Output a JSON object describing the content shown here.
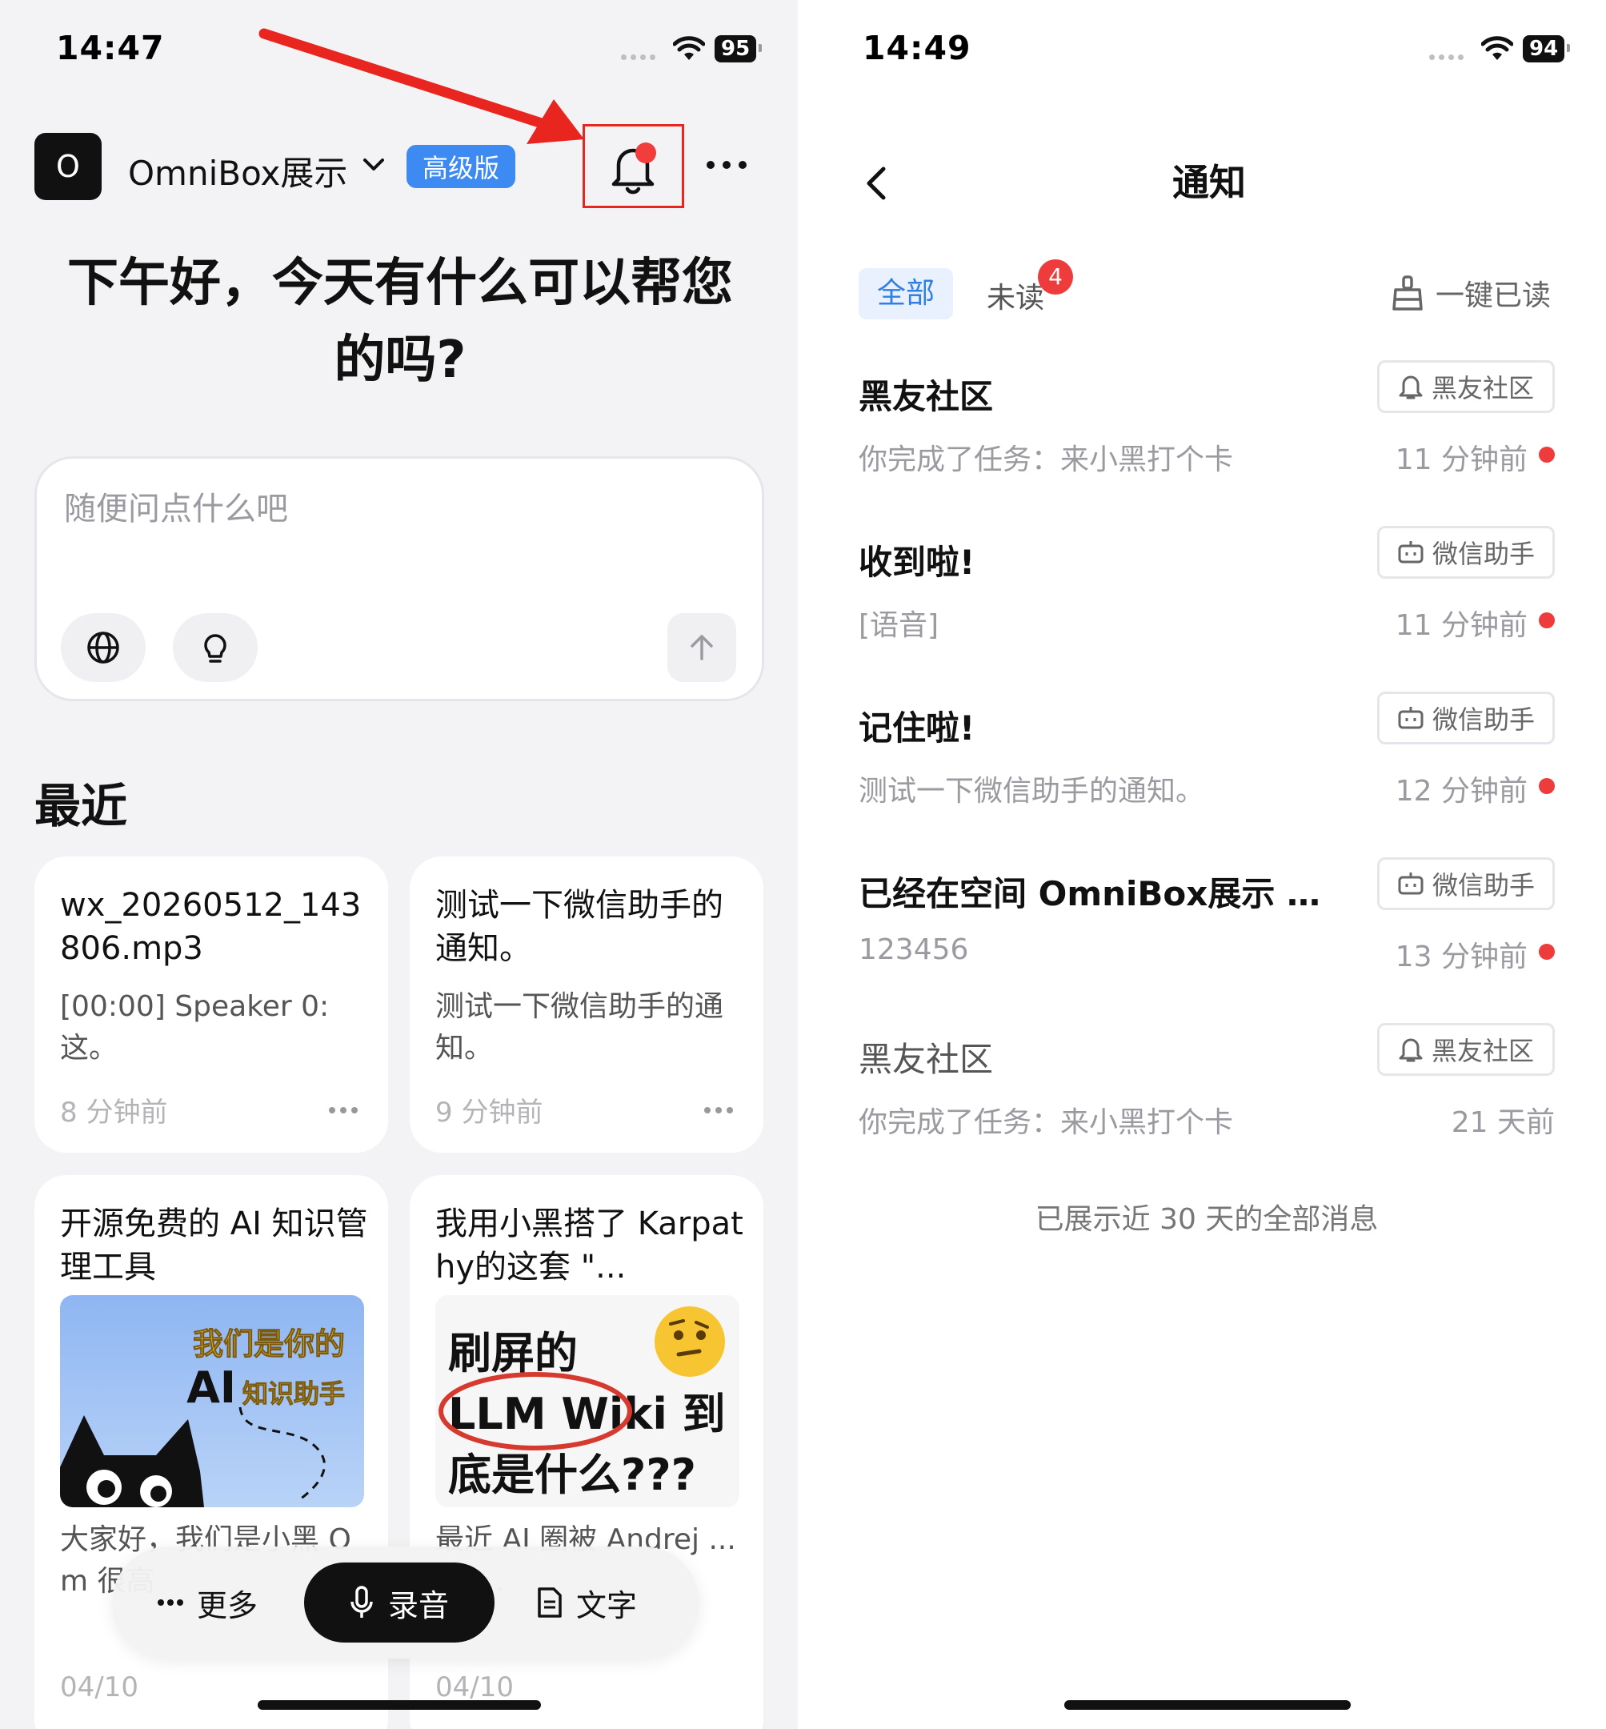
{
  "left": {
    "status": {
      "time": "14:47",
      "battery": "95"
    },
    "header": {
      "app_initial": "O",
      "space_name": "OmniBox展示",
      "plan_badge": "高级版",
      "notification_icon": "bell-icon",
      "more_icon": "more-horizontal-icon"
    },
    "greeting": "下午好，今天有什么可以帮您的吗?",
    "composer": {
      "placeholder": "随便问点什么吧",
      "web_search_icon": "globe-icon",
      "ideas_icon": "lightbulb-icon",
      "send_icon": "arrow-up-icon"
    },
    "recent": {
      "title": "最近",
      "items": [
        {
          "title": "wx_20260512_143806.mp3",
          "body": "[00:00] Speaker 0: 这。",
          "time": "8 分钟前"
        },
        {
          "title": "测试一下微信助手的通知。",
          "body": "测试一下微信助手的通知。",
          "time": "9 分钟前"
        },
        {
          "title": "开源免费的 AI 知识管理工具",
          "thumb_line1": "我们是你的",
          "thumb_line2_big": "AI",
          "thumb_line2_small": "知识助手",
          "body": "大家好，我们是小黑 Om 很高",
          "time": "04/10"
        },
        {
          "title": "我用小黑搭了 Karpathy的这套 \"...",
          "thumb_line1": "刷屏的",
          "thumb_line2": "LLM Wiki 到",
          "thumb_line3": "底是什么???",
          "body": "最近 AI 圈被 Andrej ... iki ...",
          "time": "04/10"
        }
      ]
    },
    "bottom_bar": {
      "more_label": "更多",
      "record_label": "录音",
      "text_label": "文字"
    }
  },
  "right": {
    "status": {
      "time": "14:49",
      "battery": "94"
    },
    "header": {
      "title": "通知",
      "back_icon": "chevron-left-icon"
    },
    "tabs": {
      "all": "全部",
      "unread": "未读",
      "unread_count": "4"
    },
    "mark_all_read": "一键已读",
    "notifications": [
      {
        "title": "黑友社区",
        "body": "你完成了任务：来小黑打个卡",
        "source": "黑友社区",
        "source_icon": "bell-icon",
        "time": "11 分钟前",
        "unread": true
      },
      {
        "title": "收到啦!",
        "body": "[语音]",
        "source": "微信助手",
        "source_icon": "bot-icon",
        "time": "11 分钟前",
        "unread": true
      },
      {
        "title": "记住啦!",
        "body": "测试一下微信助手的通知。",
        "source": "微信助手",
        "source_icon": "bot-icon",
        "time": "12 分钟前",
        "unread": true
      },
      {
        "title": "已经在空间 OmniBox展示 里...",
        "body": "123456",
        "source": "微信助手",
        "source_icon": "bot-icon",
        "time": "13 分钟前",
        "unread": true
      },
      {
        "title": "黑友社区",
        "body": "你完成了任务：来小黑打个卡",
        "source": "黑友社区",
        "source_icon": "bell-icon",
        "time": "21 天前",
        "unread": false
      }
    ],
    "footer_note": "已展示近 30 天的全部消息"
  },
  "colors": {
    "accent_blue": "#3d8bf2",
    "annotation_red": "#e8251f",
    "unread_red": "#ee3b3b"
  }
}
